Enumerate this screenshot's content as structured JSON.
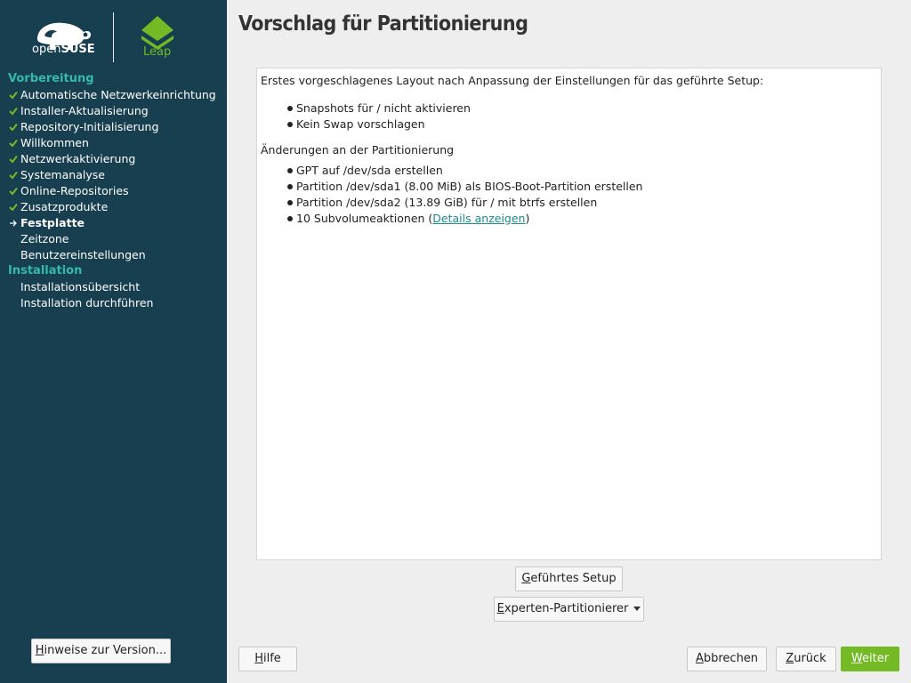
{
  "sidebar": {
    "brand": {
      "opensuse_prefix": "open",
      "opensuse_suffix": "SUSE",
      "leap": "Leap"
    },
    "sections": [
      {
        "title": "Vorbereitung",
        "steps": [
          {
            "label": "Automatische Netzwerkeinrichtung",
            "state": "done"
          },
          {
            "label": "Installer-Aktualisierung",
            "state": "done"
          },
          {
            "label": "Repository-Initialisierung",
            "state": "done"
          },
          {
            "label": "Willkommen",
            "state": "done"
          },
          {
            "label": "Netzwerkaktivierung",
            "state": "done"
          },
          {
            "label": "Systemanalyse",
            "state": "done"
          },
          {
            "label": "Online-Repositories",
            "state": "done"
          },
          {
            "label": "Zusatzprodukte",
            "state": "done"
          },
          {
            "label": "Festplatte",
            "state": "current"
          },
          {
            "label": "Zeitzone",
            "state": "pending"
          },
          {
            "label": "Benutzereinstellungen",
            "state": "pending"
          }
        ]
      },
      {
        "title": "Installation",
        "steps": [
          {
            "label": "Installationsübersicht",
            "state": "pending"
          },
          {
            "label": "Installation durchführen",
            "state": "pending"
          }
        ]
      }
    ],
    "release_notes_button": {
      "mnemonic": "H",
      "rest": "inweise zur Version..."
    }
  },
  "main": {
    "title": "Vorschlag für Partitionierung",
    "intro": "Erstes vorgeschlagenes Layout nach Anpassung der Einstellungen für das geführte Setup:",
    "settings": [
      "Snapshots für / nicht aktivieren",
      "Kein Swap vorschlagen"
    ],
    "changes_heading": "Änderungen an der Partitionierung",
    "changes": [
      "GPT auf /dev/sda erstellen",
      "Partition /dev/sda1 (8.00 MiB) als BIOS-Boot-Partition erstellen",
      "Partition /dev/sda2 (13.89 GiB) für / mit btrfs erstellen"
    ],
    "subvolume_item": {
      "prefix": "10 Subvolumeaktionen (",
      "link": "Details anzeigen",
      "suffix": ")"
    },
    "guided_setup_button": {
      "mnemonic": "G",
      "rest": "eführtes Setup"
    },
    "expert_button": {
      "mnemonic": "E",
      "rest": "xperten-Partitionierer"
    }
  },
  "footer": {
    "help": {
      "mnemonic": "H",
      "rest": "ilfe"
    },
    "abort": {
      "mnemonic": "A",
      "rest": "bbrechen"
    },
    "back": {
      "mnemonic": "Z",
      "rest": "urück"
    },
    "next": {
      "mnemonic": "W",
      "rest": "eiter"
    }
  },
  "colors": {
    "sidebar_bg": "#173f4f",
    "section_title": "#35b9ab",
    "accent_green": "#73ba25",
    "link": "#1a8b8b"
  }
}
